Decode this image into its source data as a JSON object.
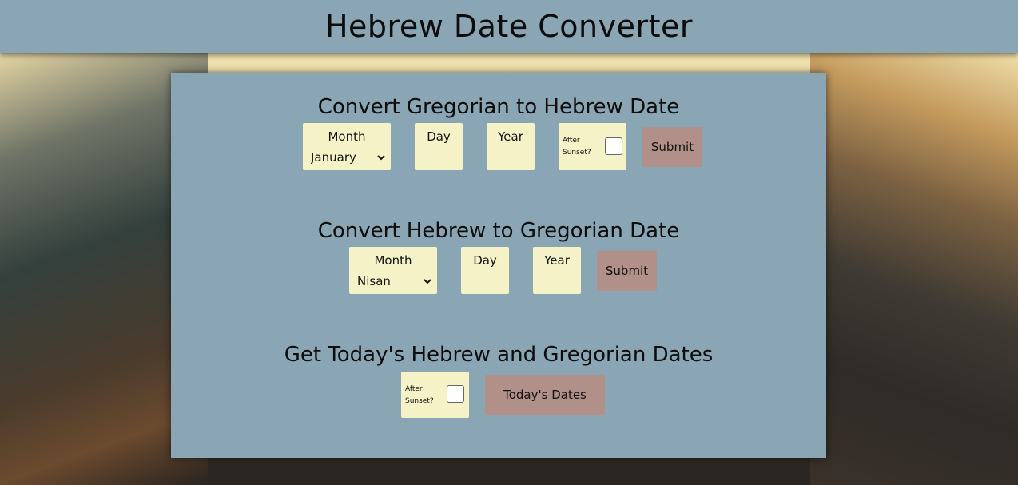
{
  "header": {
    "title": "Hebrew Date Converter"
  },
  "greg_to_heb": {
    "heading": "Convert Gregorian to Hebrew Date",
    "month_label": "Month",
    "month_value": "January",
    "day_label": "Day",
    "year_label": "Year",
    "sunset_label_line1": "After",
    "sunset_label_line2": "Sunset?",
    "submit_label": "Submit"
  },
  "heb_to_greg": {
    "heading": "Convert Hebrew to Gregorian Date",
    "month_label": "Month",
    "month_value": "Nisan",
    "day_label": "Day",
    "year_label": "Year",
    "submit_label": "Submit"
  },
  "today": {
    "heading": "Get Today's Hebrew and Gregorian Dates",
    "sunset_label_line1": "After",
    "sunset_label_line2": "Sunset?",
    "button_label": "Today's Dates"
  },
  "colors": {
    "panel": "#8aa5b3",
    "field": "#f6f2c8",
    "button": "#b09088"
  },
  "icons": [
    "chevron-down-icon"
  ]
}
